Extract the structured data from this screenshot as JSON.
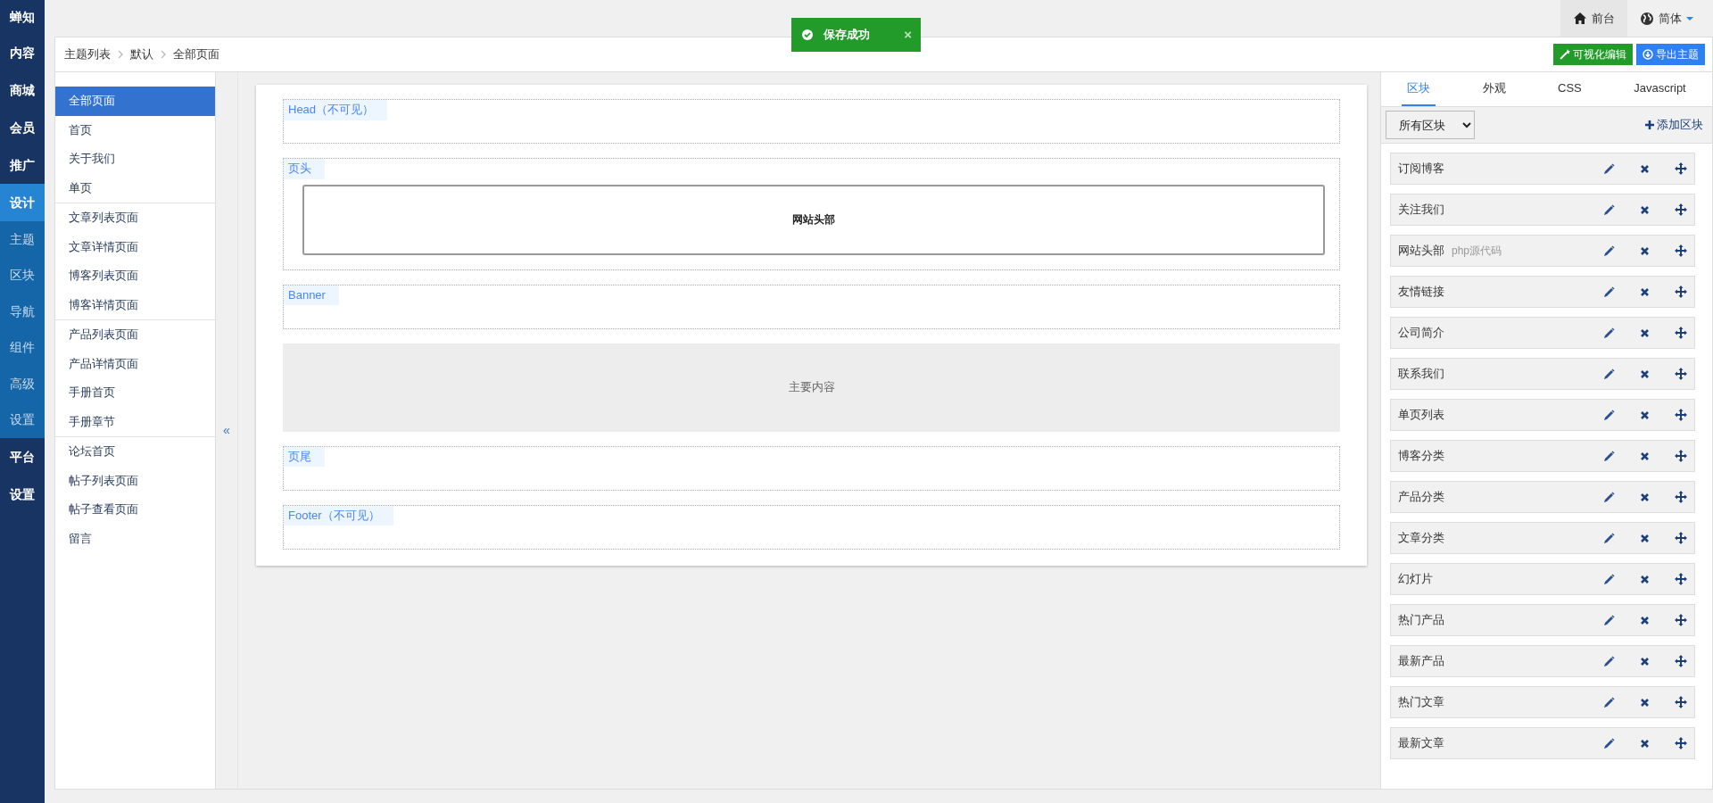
{
  "brand": "蝉知",
  "nav": [
    {
      "label": "内容",
      "selected": false
    },
    {
      "label": "商城",
      "selected": false
    },
    {
      "label": "会员",
      "selected": false
    },
    {
      "label": "推广",
      "selected": false
    },
    {
      "label": "设计",
      "selected": true,
      "children": [
        {
          "label": "主题",
          "selected": false
        },
        {
          "label": "区块",
          "selected": false
        },
        {
          "label": "导航",
          "selected": false
        },
        {
          "label": "组件",
          "selected": false
        },
        {
          "label": "高级",
          "selected": false
        },
        {
          "label": "设置",
          "selected": false
        }
      ]
    },
    {
      "label": "平台",
      "selected": false
    },
    {
      "label": "设置",
      "selected": false
    }
  ],
  "top_links": [
    {
      "label": "前台",
      "kind": "home"
    },
    {
      "label": "简体",
      "kind": "language"
    }
  ],
  "toast": {
    "text": "保存成功",
    "close": "×"
  },
  "breadcrumb": [
    "主题列表",
    "默认",
    "全部页面"
  ],
  "actions": [
    {
      "label": "可视化编辑",
      "kind": "visual"
    },
    {
      "label": "导出主题",
      "kind": "export"
    }
  ],
  "pages": [
    [
      {
        "label": "全部页面",
        "selected": true
      },
      {
        "label": "首页",
        "selected": false
      },
      {
        "label": "关于我们",
        "selected": false
      },
      {
        "label": "单页",
        "selected": false
      }
    ],
    [
      {
        "label": "文章列表页面",
        "selected": false
      },
      {
        "label": "文章详情页面",
        "selected": false
      },
      {
        "label": "博客列表页面",
        "selected": false
      },
      {
        "label": "博客详情页面",
        "selected": false
      }
    ],
    [
      {
        "label": "产品列表页面",
        "selected": false
      },
      {
        "label": "产品详情页面",
        "selected": false
      },
      {
        "label": "手册首页",
        "selected": false
      },
      {
        "label": "手册章节",
        "selected": false
      }
    ],
    [
      {
        "label": "论坛首页",
        "selected": false
      },
      {
        "label": "帖子列表页面",
        "selected": false
      },
      {
        "label": "帖子查看页面",
        "selected": false
      },
      {
        "label": "留言",
        "selected": false
      }
    ]
  ],
  "collapse": "«",
  "regions": [
    {
      "kind": "region",
      "label": "Head（不可见）"
    },
    {
      "kind": "region",
      "label": "页头",
      "blocks": [
        "网站头部"
      ]
    },
    {
      "kind": "region",
      "label": "Banner"
    },
    {
      "kind": "main",
      "label": "主要内容"
    },
    {
      "kind": "region",
      "label": "页尾"
    },
    {
      "kind": "region",
      "label": "Footer（不可见）"
    }
  ],
  "tabs": [
    {
      "label": "区块",
      "selected": true
    },
    {
      "label": "外观",
      "selected": false
    },
    {
      "label": "CSS",
      "selected": false
    },
    {
      "label": "Javascript",
      "selected": false
    }
  ],
  "filter": {
    "value": "所有区块"
  },
  "add_block": "添加区块",
  "blocks": [
    {
      "name": "订阅博客"
    },
    {
      "name": "关注我们"
    },
    {
      "name": "网站头部",
      "note": "php源代码"
    },
    {
      "name": "友情链接"
    },
    {
      "name": "公司简介"
    },
    {
      "name": "联系我们"
    },
    {
      "name": "单页列表"
    },
    {
      "name": "博客分类"
    },
    {
      "name": "产品分类"
    },
    {
      "name": "文章分类"
    },
    {
      "name": "幻灯片"
    },
    {
      "name": "热门产品"
    },
    {
      "name": "最新产品"
    },
    {
      "name": "热门文章"
    },
    {
      "name": "最新文章"
    }
  ]
}
